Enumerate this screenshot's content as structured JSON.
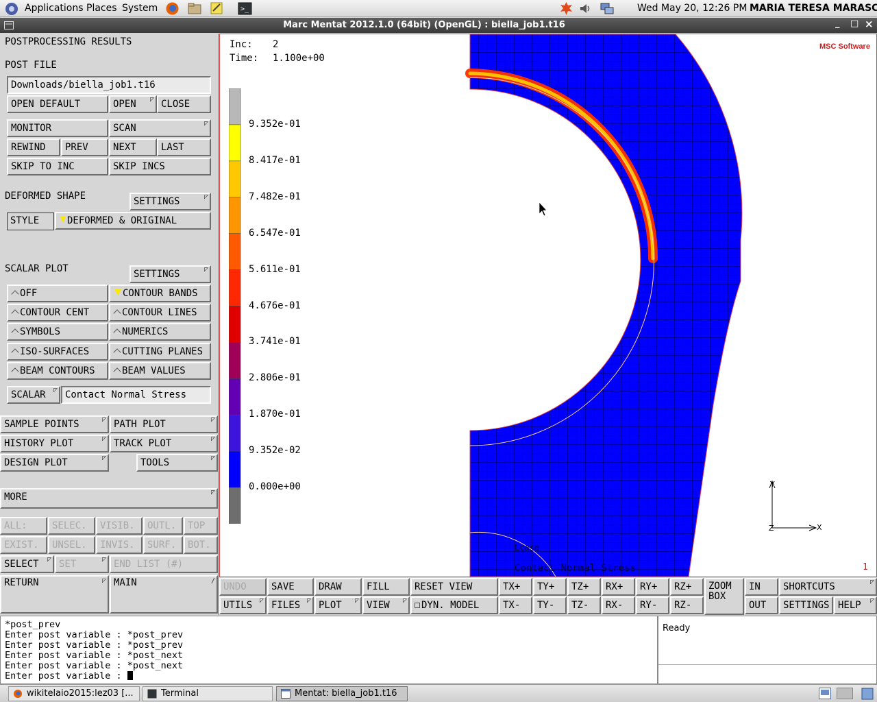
{
  "topbar": {
    "applications": "Applications",
    "places": "Places",
    "system": "System",
    "clock": "Wed May 20, 12:26 PM",
    "user": "MARIA TERESA MARASCO",
    "alert_count": "!"
  },
  "window": {
    "title": "Marc Mentat 2012.1.0 (64bit) (OpenGL) : biella_job1.t16",
    "min": "_",
    "max": "□",
    "close": "×"
  },
  "left": {
    "postprocessing_title": "POSTPROCESSING RESULTS",
    "post_file_label": "POST FILE",
    "post_file_value": "Downloads/biella_job1.t16",
    "open_default": "OPEN DEFAULT",
    "open": "OPEN",
    "close": "CLOSE",
    "monitor": "MONITOR",
    "scan": "SCAN",
    "rewind": "REWIND",
    "prev": "PREV",
    "next": "NEXT",
    "last": "LAST",
    "skip_to_inc": "SKIP TO INC",
    "skip_incs": "SKIP INCS",
    "deformed_shape": "DEFORMED SHAPE",
    "settings": "SETTINGS",
    "style": "STYLE",
    "style_value": "DEFORMED & ORIGINAL",
    "scalar_plot": "SCALAR PLOT",
    "off": "OFF",
    "contour_bands": "CONTOUR BANDS",
    "contour_cent": "CONTOUR CENT",
    "contour_lines": "CONTOUR LINES",
    "symbols": "SYMBOLS",
    "numerics": "NUMERICS",
    "iso_surfaces": "ISO-SURFACES",
    "cutting_planes": "CUTTING PLANES",
    "beam_contours": "BEAM CONTOURS",
    "beam_values": "BEAM VALUES",
    "scalar": "SCALAR",
    "scalar_value": "Contact Normal Stress",
    "sample_points": "SAMPLE POINTS",
    "path_plot": "PATH PLOT",
    "history_plot": "HISTORY PLOT",
    "track_plot": "TRACK PLOT",
    "design_plot": "DESIGN PLOT",
    "tools": "TOOLS",
    "more": "MORE",
    "all": "ALL:",
    "selec": "SELEC.",
    "visib": "VISIB.",
    "outl": "OUTL.",
    "top": "TOP",
    "exist": "EXIST.",
    "unsel": "UNSEL.",
    "invis": "INVIS.",
    "surf": "SURF.",
    "bot": "BOT.",
    "select": "SELECT",
    "set": "SET",
    "end_list": "END LIST (#)",
    "return": "RETURN",
    "main": "MAIN"
  },
  "viewport": {
    "inc_label": "Inc:",
    "inc_value": "2",
    "time_label": "Time:",
    "time_value": "1.100e+00",
    "legend": [
      "9.352e-01",
      "8.417e-01",
      "7.482e-01",
      "6.547e-01",
      "5.611e-01",
      "4.676e-01",
      "3.741e-01",
      "2.806e-01",
      "1.870e-01",
      "9.352e-02",
      "0.000e+00"
    ],
    "legend_colors": [
      "#b8b8b8",
      "#ffff00",
      "#ffc800",
      "#ff9600",
      "#ff5a00",
      "#ff2800",
      "#e00000",
      "#a00058",
      "#6400b4",
      "#3c14dc",
      "#0000ff",
      "#6e6e6e"
    ],
    "logo": "MSC Software",
    "axis_x": "X",
    "axis_y": "Y",
    "axis_z": "Z",
    "viewport_no": "1",
    "bottom_caption": "Contact Normal Stress",
    "bottom_caption2": "Lcase"
  },
  "toolbar": {
    "undo": "UNDO",
    "save": "SAVE",
    "draw": "DRAW",
    "fill": "FILL",
    "reset_view": "RESET VIEW",
    "tx_plus": "TX+",
    "ty_plus": "TY+",
    "tz_plus": "TZ+",
    "rx_plus": "RX+",
    "ry_plus": "RY+",
    "rz_plus": "RZ+",
    "zoom_box": "ZOOM BOX",
    "in": "IN",
    "shortcuts": "SHORTCUTS",
    "utils": "UTILS",
    "files": "FILES",
    "plot": "PLOT",
    "view": "VIEW",
    "dyn_model": "DYN. MODEL",
    "tx_minus": "TX-",
    "ty_minus": "TY-",
    "tz_minus": "TZ-",
    "rx_minus": "RX-",
    "ry_minus": "RY-",
    "rz_minus": "RZ-",
    "out": "OUT",
    "settings": "SETTINGS",
    "help": "HELP"
  },
  "command": {
    "lines": [
      "*post_prev",
      "Enter post variable : *post_prev",
      "Enter post variable : *post_prev",
      "Enter post variable : *post_next",
      "Enter post variable : *post_next",
      "Enter post variable : "
    ]
  },
  "status": {
    "text": "Ready"
  },
  "taskbar": {
    "items": [
      "wikitelaio2015:lez03 [...",
      "Terminal",
      "Mentat: biella_job1.t16"
    ]
  }
}
